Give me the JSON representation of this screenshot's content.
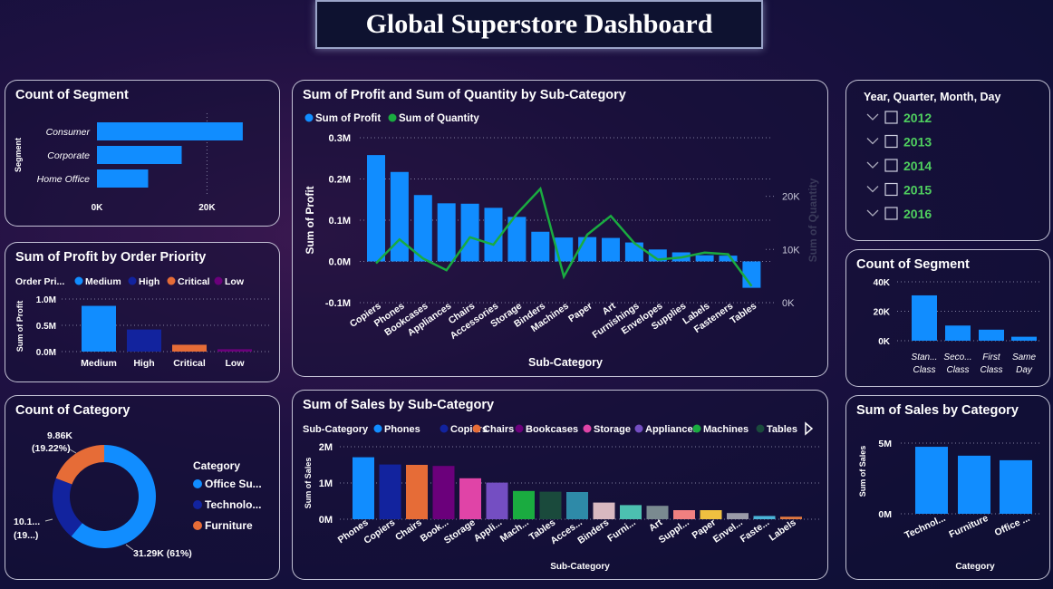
{
  "dashboard": {
    "title": "Global Superstore Dashboard"
  },
  "colors": {
    "blue": "#118dff",
    "navy": "#12239e",
    "orange": "#e66c37",
    "purple": "#6b007b",
    "pink": "#e044a7",
    "indigo": "#744ec2",
    "green": "#1aab40",
    "darkteal": "#15a6a6"
  },
  "chart_data": [
    {
      "id": "segment_bar",
      "type": "bar",
      "orientation": "horizontal",
      "title": "Count of Segment",
      "ylabel": "Segment",
      "categories": [
        "Consumer",
        "Corporate",
        "Home Office"
      ],
      "values": [
        26500,
        15400,
        9300
      ],
      "xlim": [
        0,
        28000
      ],
      "xticks": [
        0,
        20000
      ],
      "xtick_labels": [
        "0K",
        "20K"
      ]
    },
    {
      "id": "profit_priority",
      "type": "bar",
      "title": "Sum of Profit by Order Priority",
      "ylabel": "Sum of Profit",
      "legend_title": "Order Pri...",
      "categories": [
        "Medium",
        "High",
        "Critical",
        "Low"
      ],
      "values": [
        870000,
        420000,
        130000,
        45000
      ],
      "colors": [
        "#118dff",
        "#12239e",
        "#e66c37",
        "#6b007b"
      ],
      "ylim": [
        0,
        1000000
      ],
      "yticks": [
        0,
        500000,
        1000000
      ],
      "ytick_labels": [
        "0.0M",
        "0.5M",
        "1.0M"
      ]
    },
    {
      "id": "category_donut",
      "type": "pie",
      "donut": true,
      "title": "Count of Category",
      "legend_title": "Category",
      "categories": [
        "Office Su...",
        "Technolo...",
        "Furniture"
      ],
      "values": [
        31290,
        10140,
        9860
      ],
      "colors": [
        "#118dff",
        "#12239e",
        "#e66c37"
      ],
      "data_labels": [
        [
          "31.29K (61%)"
        ],
        [
          "10.1...",
          "(19...)"
        ],
        [
          "9.86K",
          "(19.22%)"
        ]
      ]
    },
    {
      "id": "profit_quantity",
      "type": "bar",
      "title": "Sum of Profit and Sum of Quantity by Sub-Category",
      "xlabel": "Sub-Category",
      "ylabel": "Sum of Profit",
      "y2label": "Sum of Quantity",
      "categories": [
        "Copiers",
        "Phones",
        "Bookcases",
        "Appliances",
        "Chairs",
        "Accessories",
        "Storage",
        "Binders",
        "Machines",
        "Paper",
        "Art",
        "Furnishings",
        "Envelopes",
        "Supplies",
        "Labels",
        "Fasteners",
        "Tables"
      ],
      "series": [
        {
          "name": "Sum of Profit",
          "type": "bar",
          "color": "#118dff",
          "values": [
            258000,
            217000,
            161000,
            141000,
            140000,
            130000,
            108000,
            72000,
            58000,
            59000,
            57000,
            46000,
            29000,
            22000,
            15000,
            14000,
            -64000
          ]
        },
        {
          "name": "Sum of Quantity",
          "type": "line",
          "color": "#1aab40",
          "axis": "right",
          "values": [
            7400,
            11900,
            8300,
            6100,
            12300,
            10900,
            16700,
            21400,
            4900,
            12800,
            16300,
            11200,
            8100,
            8500,
            9400,
            9100,
            3100
          ]
        }
      ],
      "ylim": [
        -100000,
        300000
      ],
      "yticks": [
        -100000,
        0,
        100000,
        200000,
        300000
      ],
      "ytick_labels": [
        "-0.1M",
        "0.0M",
        "0.1M",
        "0.2M",
        "0.3M"
      ],
      "y2lim": [
        0,
        31000
      ],
      "y2ticks": [
        0,
        10000,
        20000
      ],
      "y2tick_labels": [
        "0K",
        "10K",
        "20K"
      ]
    },
    {
      "id": "sales_subcat",
      "type": "bar",
      "title": "Sum of Sales by Sub-Category",
      "xlabel": "Sub-Category",
      "ylabel": "Sum of Sales",
      "legend_title": "Sub-Category",
      "legend": [
        "Phones",
        "Copiers",
        "Chairs",
        "Bookcases",
        "Storage",
        "Appliances",
        "Machines",
        "Tables"
      ],
      "categories": [
        "Phones",
        "Copiers",
        "Chairs",
        "Book...",
        "Storage",
        "Appli...",
        "Mach...",
        "Tables",
        "Acces...",
        "Binders",
        "Furni...",
        "Art",
        "Suppl...",
        "Paper",
        "Envel...",
        "Faste...",
        "Labels"
      ],
      "values": [
        1710000,
        1510000,
        1500000,
        1470000,
        1130000,
        1010000,
        780000,
        760000,
        750000,
        460000,
        390000,
        370000,
        250000,
        250000,
        170000,
        90000,
        70000
      ],
      "colors": [
        "#118dff",
        "#12239e",
        "#e66c37",
        "#6b007b",
        "#e044a7",
        "#744ec2",
        "#1aab40",
        "#1a4a3c",
        "#2e8aa8",
        "#d8b8c0",
        "#4cc0b0",
        "#7a8a90",
        "#f08080",
        "#f0c040",
        "#9a9aa8",
        "#4ab4d8",
        "#e07840"
      ],
      "ylim": [
        0,
        2000000
      ],
      "yticks": [
        0,
        1000000,
        2000000
      ],
      "ytick_labels": [
        "0M",
        "1M",
        "2M"
      ]
    },
    {
      "id": "segment_ship",
      "type": "bar",
      "title": "Count of Segment",
      "categories": [
        [
          "Stan...",
          "Class"
        ],
        [
          "Seco...",
          "Class"
        ],
        [
          "First",
          "Class"
        ],
        [
          "Same",
          "Day"
        ]
      ],
      "values": [
        30800,
        10300,
        7500,
        2700
      ],
      "ylim": [
        0,
        40000
      ],
      "yticks": [
        0,
        20000,
        40000
      ],
      "ytick_labels": [
        "0K",
        "20K",
        "40K"
      ]
    },
    {
      "id": "sales_category",
      "type": "bar",
      "title": "Sum of Sales by Category",
      "xlabel": "Category",
      "ylabel": "Sum of Sales",
      "categories": [
        "Technol...",
        "Furniture",
        "Office ..."
      ],
      "values": [
        4740000,
        4110000,
        3790000
      ],
      "ylim": [
        0,
        5000000
      ],
      "yticks": [
        0,
        5000000
      ],
      "ytick_labels": [
        "0M",
        "5M"
      ]
    }
  ],
  "slicer": {
    "title": "Year, Quarter, Month, Day",
    "items": [
      "2012",
      "2013",
      "2014",
      "2015",
      "2016"
    ]
  }
}
